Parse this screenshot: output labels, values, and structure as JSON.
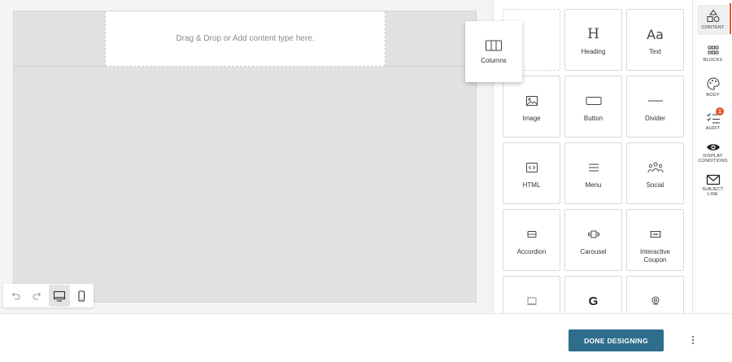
{
  "canvas": {
    "dropzone_text": "Drag & Drop or Add content type here."
  },
  "drag_preview": {
    "label": "Columns",
    "icon": "columns-icon"
  },
  "toolbar": {
    "undo_icon": "undo-icon",
    "redo_icon": "redo-icon",
    "desktop_icon": "desktop-icon",
    "mobile_icon": "mobile-icon",
    "active_view": "desktop"
  },
  "content_tiles": [
    {
      "label": "",
      "icon": "empty"
    },
    {
      "label": "Heading",
      "icon": "heading-icon"
    },
    {
      "label": "Text",
      "icon": "text-icon"
    },
    {
      "label": "Image",
      "icon": "image-icon"
    },
    {
      "label": "Button",
      "icon": "button-icon"
    },
    {
      "label": "Divider",
      "icon": "divider-icon"
    },
    {
      "label": "HTML",
      "icon": "html-icon"
    },
    {
      "label": "Menu",
      "icon": "menu-icon"
    },
    {
      "label": "Social",
      "icon": "social-icon"
    },
    {
      "label": "Accordion",
      "icon": "accordion-icon"
    },
    {
      "label": "Carousel",
      "icon": "carousel-icon"
    },
    {
      "label": "Interactive Coupon",
      "icon": "coupon-icon"
    },
    {
      "label": "",
      "icon": "form-icon"
    },
    {
      "label": "",
      "icon": "google-icon"
    },
    {
      "label": "",
      "icon": "location-icon"
    }
  ],
  "sidebar": {
    "items": [
      {
        "label": "CONTENT",
        "icon": "shapes-icon"
      },
      {
        "label": "BLOCKS",
        "icon": "blocks-icon"
      },
      {
        "label": "BODY",
        "icon": "palette-icon"
      },
      {
        "label": "AUDIT",
        "icon": "checklist-icon",
        "badge": "1"
      },
      {
        "label": "DISPLAY CONDITIONS",
        "icon": "eye-icon"
      },
      {
        "label": "SUBJECT LINE",
        "icon": "envelope-icon"
      }
    ],
    "accent_color": "#e4572e"
  },
  "footer": {
    "done_label": "DONE DESIGNING",
    "done_color": "#2f6d8c",
    "more_icon": "more-vertical-icon"
  }
}
